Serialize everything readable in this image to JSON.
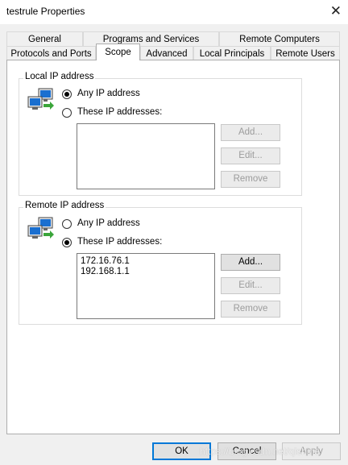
{
  "window": {
    "title": "testrule Properties",
    "close_glyph": "✕"
  },
  "tabs": {
    "row1": [
      "General",
      "Programs and Services",
      "Remote Computers"
    ],
    "row2": [
      "Protocols and Ports",
      "Scope",
      "Advanced",
      "Local Principals",
      "Remote Users"
    ],
    "active": "Scope"
  },
  "local": {
    "title": "Local IP address",
    "any_label": "Any IP address",
    "these_label": "These IP addresses:",
    "selected": "any",
    "addresses": [],
    "add_label": "Add...",
    "edit_label": "Edit...",
    "remove_label": "Remove",
    "add_enabled": false,
    "edit_enabled": false,
    "remove_enabled": false,
    "icon": "network-computers-icon"
  },
  "remote": {
    "title": "Remote IP address",
    "any_label": "Any IP address",
    "these_label": "These IP addresses:",
    "selected": "these",
    "addresses": [
      "172.16.76.1",
      "192.168.1.1"
    ],
    "add_label": "Add...",
    "edit_label": "Edit...",
    "remove_label": "Remove",
    "add_enabled": true,
    "edit_enabled": false,
    "remove_enabled": false,
    "icon": "network-computers-icon"
  },
  "footer": {
    "ok_label": "OK",
    "cancel_label": "Cancel",
    "apply_label": "Apply"
  },
  "watermark": "https://blog.csdn.net/qishine",
  "colors": {
    "focus_border": "#0078d7",
    "window_background": "#f0f0f0",
    "panel_background": "#ffffff"
  }
}
